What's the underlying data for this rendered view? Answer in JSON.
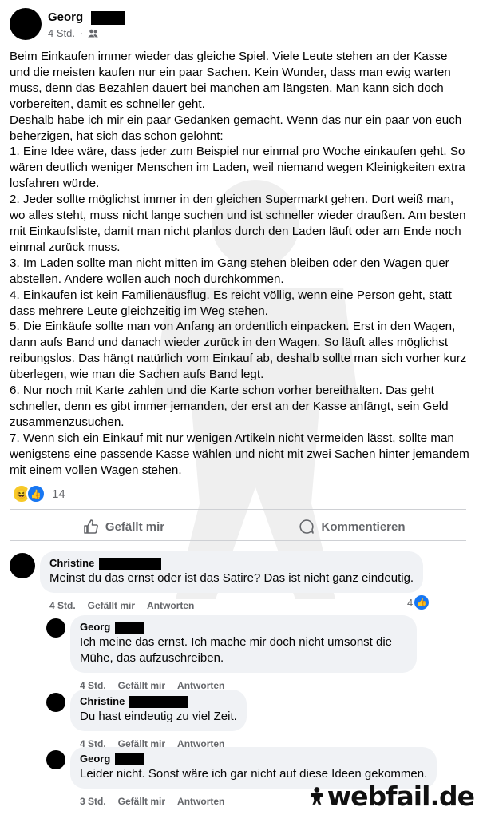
{
  "post": {
    "author": "Georg",
    "time": "4 Std.",
    "audience_icon": "friends-icon",
    "paragraphs": [
      "Beim Einkaufen immer wieder das gleiche Spiel. Viele Leute stehen an der Kasse und die meisten kaufen nur ein paar Sachen. Kein Wunder, dass man ewig warten muss, denn das Bezahlen dauert bei manchen am längsten. Man kann sich doch vorbereiten, damit es schneller geht.",
      "Deshalb habe ich mir ein paar Gedanken gemacht. Wenn das nur ein paar von euch beherzigen, hat sich das schon gelohnt:",
      "1. Eine Idee wäre, dass jeder zum Beispiel nur einmal pro Woche einkaufen geht. So wären deutlich weniger Menschen im Laden, weil niemand wegen Kleinigkeiten extra losfahren würde.",
      "2. Jeder sollte möglichst immer in den gleichen Supermarkt gehen. Dort weiß man, wo alles steht, muss nicht lange suchen und ist schneller wieder draußen. Am besten mit Einkaufsliste, damit man nicht planlos durch den Laden läuft oder am Ende noch einmal zurück muss.",
      "3. Im Laden sollte man nicht mitten im Gang stehen bleiben oder den Wagen quer abstellen. Andere wollen auch noch durchkommen.",
      "4. Einkaufen ist kein Familienausflug. Es reicht völlig, wenn eine Person geht, statt dass mehrere Leute gleichzeitig im Weg stehen.",
      "5. Die Einkäufe sollte man von Anfang an ordentlich einpacken. Erst in den Wagen, dann aufs Band und danach wieder zurück in den Wagen. So läuft alles möglichst reibungslos. Das hängt natürlich vom Einkauf ab, deshalb sollte man sich vorher kurz überlegen, wie man die Sachen aufs Band legt.",
      "6. Nur noch mit Karte zahlen und die Karte schon vorher bereithalten. Das geht schneller, denn es gibt immer jemanden, der erst an der Kasse anfängt, sein Geld zusammenzusuchen.",
      "7. Wenn sich ein Einkauf mit nur wenigen Artikeln nicht vermeiden lässt, sollte man wenigstens eine passende Kasse wählen und nicht mit zwei Sachen hinter jemandem mit einem vollen Wagen stehen."
    ],
    "reaction_count": "14",
    "like_label": "Gefällt mir",
    "comment_label": "Kommentieren"
  },
  "comments": [
    {
      "author": "Christine",
      "text": "Meinst du das ernst oder ist das Satire? Das ist nicht ganz eindeutig.",
      "time": "4 Std.",
      "like": "Gefällt mir",
      "reply": "Antworten",
      "likes": "4"
    },
    {
      "author": "Georg",
      "text": "Ich meine das ernst. Ich mache mir doch nicht umsonst die Mühe, das aufzuschreiben.",
      "time": "4 Std.",
      "like": "Gefällt mir",
      "reply": "Antworten"
    },
    {
      "author": "Christine",
      "text": "Du hast eindeutig zu viel Zeit.",
      "time": "4 Std.",
      "like": "Gefällt mir",
      "reply": "Antworten"
    },
    {
      "author": "Georg",
      "text": "Leider nicht. Sonst wäre ich gar nicht auf diese Ideen gekommen.",
      "time": "3 Std.",
      "like": "Gefällt mir",
      "reply": "Antworten"
    }
  ],
  "brand": {
    "name": "webfail",
    "dot": ".",
    "tld": "de"
  },
  "colors": {
    "accent": "#1877f2",
    "muted": "#65676b",
    "bubble": "#f0f2f5"
  }
}
